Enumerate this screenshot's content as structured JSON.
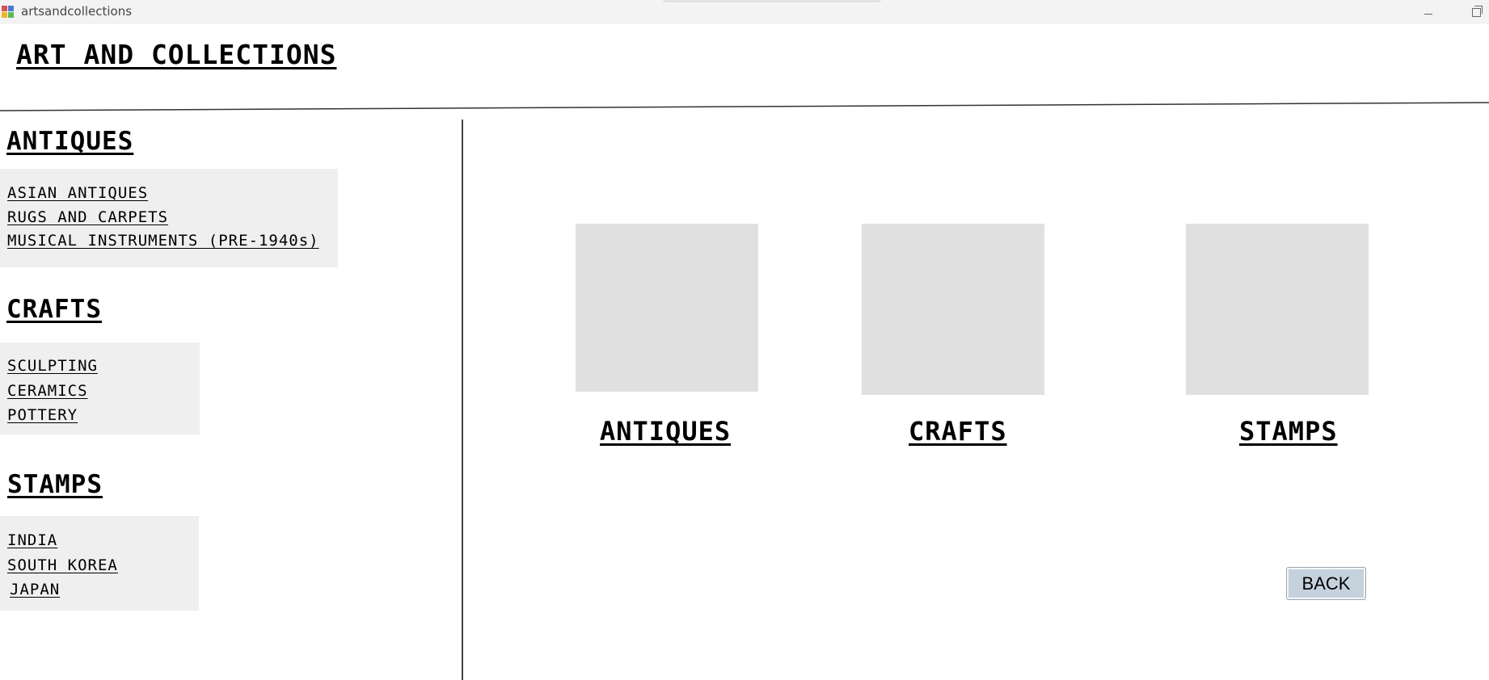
{
  "window": {
    "title": "artsandcollections"
  },
  "header": {
    "title": "ART AND COLLECTIONS"
  },
  "sidebar": {
    "sections": [
      {
        "heading": "ANTIQUES",
        "items": [
          "ASIAN ANTIQUES",
          "RUGS AND CARPETS",
          "MUSICAL INSTRUMENTS (PRE-1940s)"
        ]
      },
      {
        "heading": "CRAFTS",
        "items": [
          "SCULPTING",
          "CERAMICS",
          "POTTERY"
        ]
      },
      {
        "heading": "STAMPS",
        "items": [
          "INDIA",
          "SOUTH KOREA",
          "JAPAN"
        ]
      }
    ]
  },
  "main": {
    "tiles": [
      {
        "label": "ANTIQUES"
      },
      {
        "label": "CRAFTS"
      },
      {
        "label": "STAMPS"
      }
    ],
    "back_label": "BACK"
  },
  "colors": {
    "titlebar": "#f3f3f3",
    "sidebar_box": "#efefef",
    "tile_placeholder": "#e0e0e0",
    "back_button": "#c5d2de"
  },
  "icons": {
    "app": "app-icon",
    "minimize": "minimize-icon",
    "restore": "restore-icon"
  }
}
